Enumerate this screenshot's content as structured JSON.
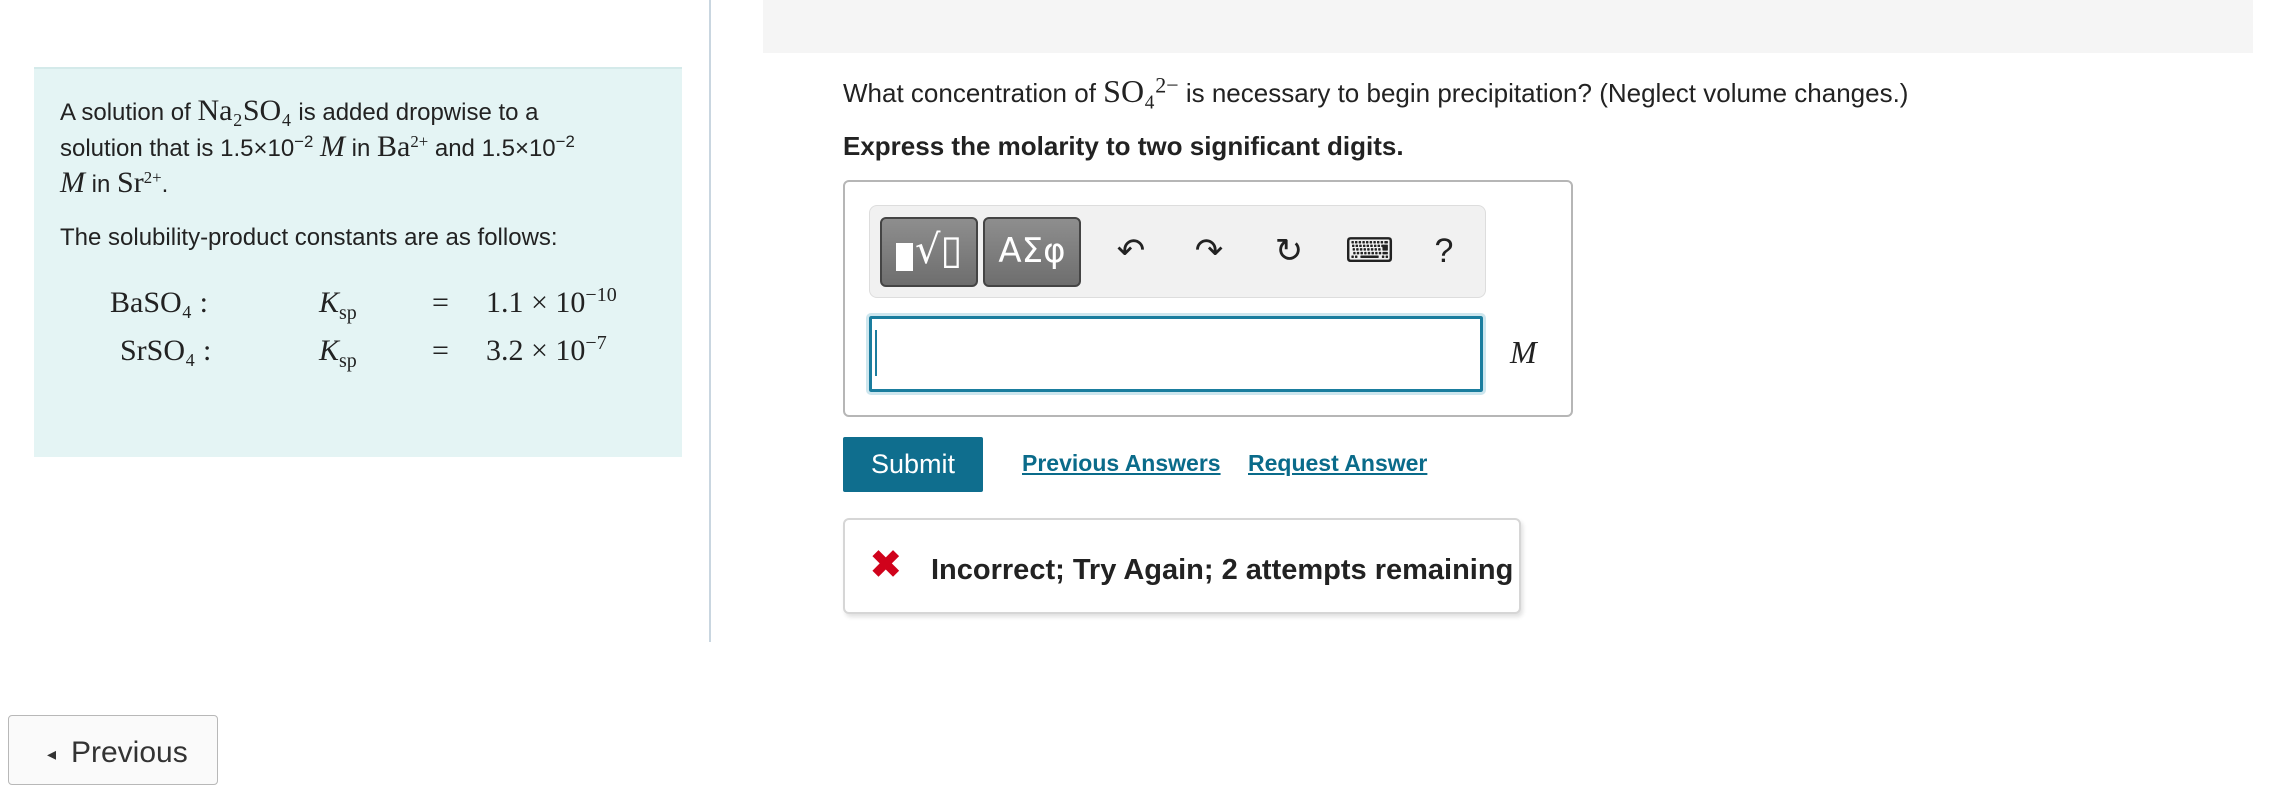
{
  "problem": {
    "line1_pre": "A solution of ",
    "reagent": "Na₂SO₄",
    "line1_post": " is added dropwise to a",
    "line2_pre": "solution that is ",
    "conc1": "1.5×10",
    "conc1_exp": "−2",
    "molar": "M",
    "in": " in ",
    "ion1": "Ba",
    "ion1_charge": "2+",
    "and": " and ",
    "conc2": "1.5×10",
    "conc2_exp": "−2",
    "ion2": "Sr",
    "ion2_charge": "2+",
    "ksp_intro": "The solubility-product constants are as follows:",
    "ksp_rows": [
      {
        "compound": "BaSO₄ :",
        "k": "K",
        "k_sub": "sp",
        "eq": "=",
        "mantissa": "1.1 × 10",
        "exponent": "−10"
      },
      {
        "compound": "SrSO₄ :",
        "k": "K",
        "k_sub": "sp",
        "eq": "=",
        "mantissa": "3.2 × 10",
        "exponent": "−7"
      }
    ]
  },
  "question": {
    "pre": "What concentration of ",
    "ion": "SO₄",
    "ion_charge": "2−",
    "post": " is necessary to begin precipitation? (Neglect volume changes.)",
    "instruction": "Express the molarity to two significant digits."
  },
  "toolbar": {
    "templates_icon": "√▯",
    "greek_label": "ΑΣφ",
    "undo_icon": "↶",
    "redo_icon": "↷",
    "reset_icon": "↻",
    "keyboard_icon": "⌨",
    "help_label": "?"
  },
  "answer": {
    "value": "",
    "unit": "M"
  },
  "actions": {
    "submit_label": "Submit",
    "previous_answers_label": "Previous Answers",
    "request_answer_label": "Request Answer"
  },
  "feedback": {
    "icon": "✖",
    "text": "Incorrect; Try Again; 2 attempts remaining"
  },
  "navigation": {
    "previous_label": "Previous",
    "previous_caret": "◂"
  }
}
